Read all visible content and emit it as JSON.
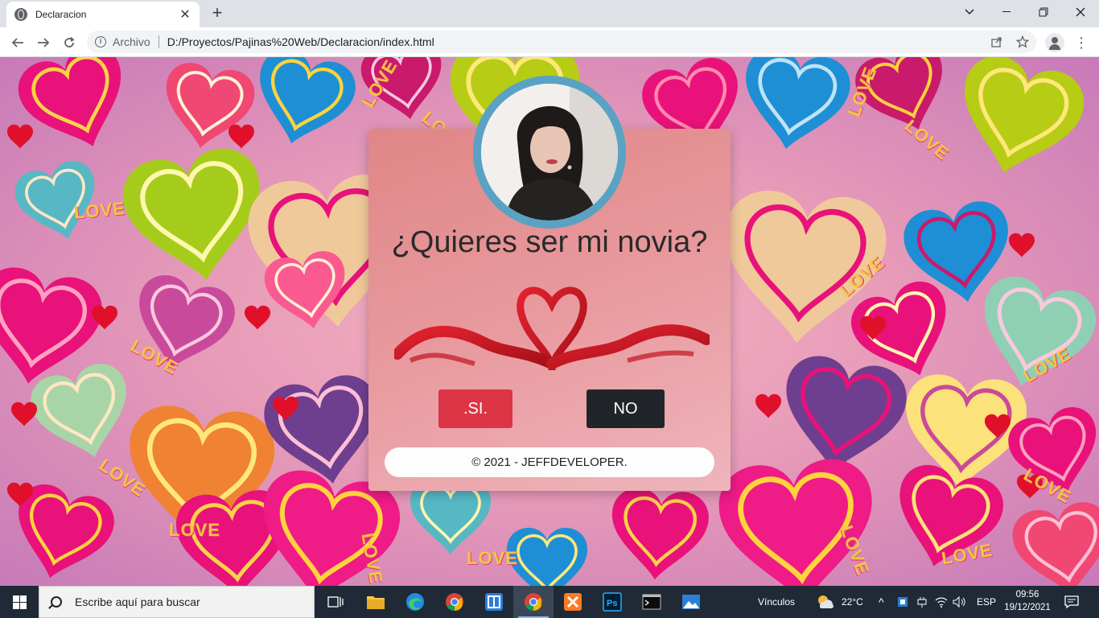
{
  "browser": {
    "tab_title": "Declaracion",
    "tab_close": "✕",
    "new_tab": "+",
    "scheme_label": "Archivo",
    "url": "D:/Proyectos/Pajinas%20Web/Declaracion/index.html"
  },
  "page": {
    "question": "¿Quieres ser mi novia?",
    "yes_label": ".SI.",
    "no_label": "NO",
    "footer": "© 2021 - JEFFDEVELOPER.",
    "love_word": "LOVE"
  },
  "taskbar": {
    "search_placeholder": "Escribe aquí para buscar",
    "links_label": "Vínculos",
    "temperature": "22°C",
    "language": "ESP",
    "time": "09:56",
    "date": "19/12/2021"
  },
  "colors": {
    "yes_button": "#dc3545",
    "no_button": "#212529",
    "avatar_ring": "#5aa2c4"
  }
}
